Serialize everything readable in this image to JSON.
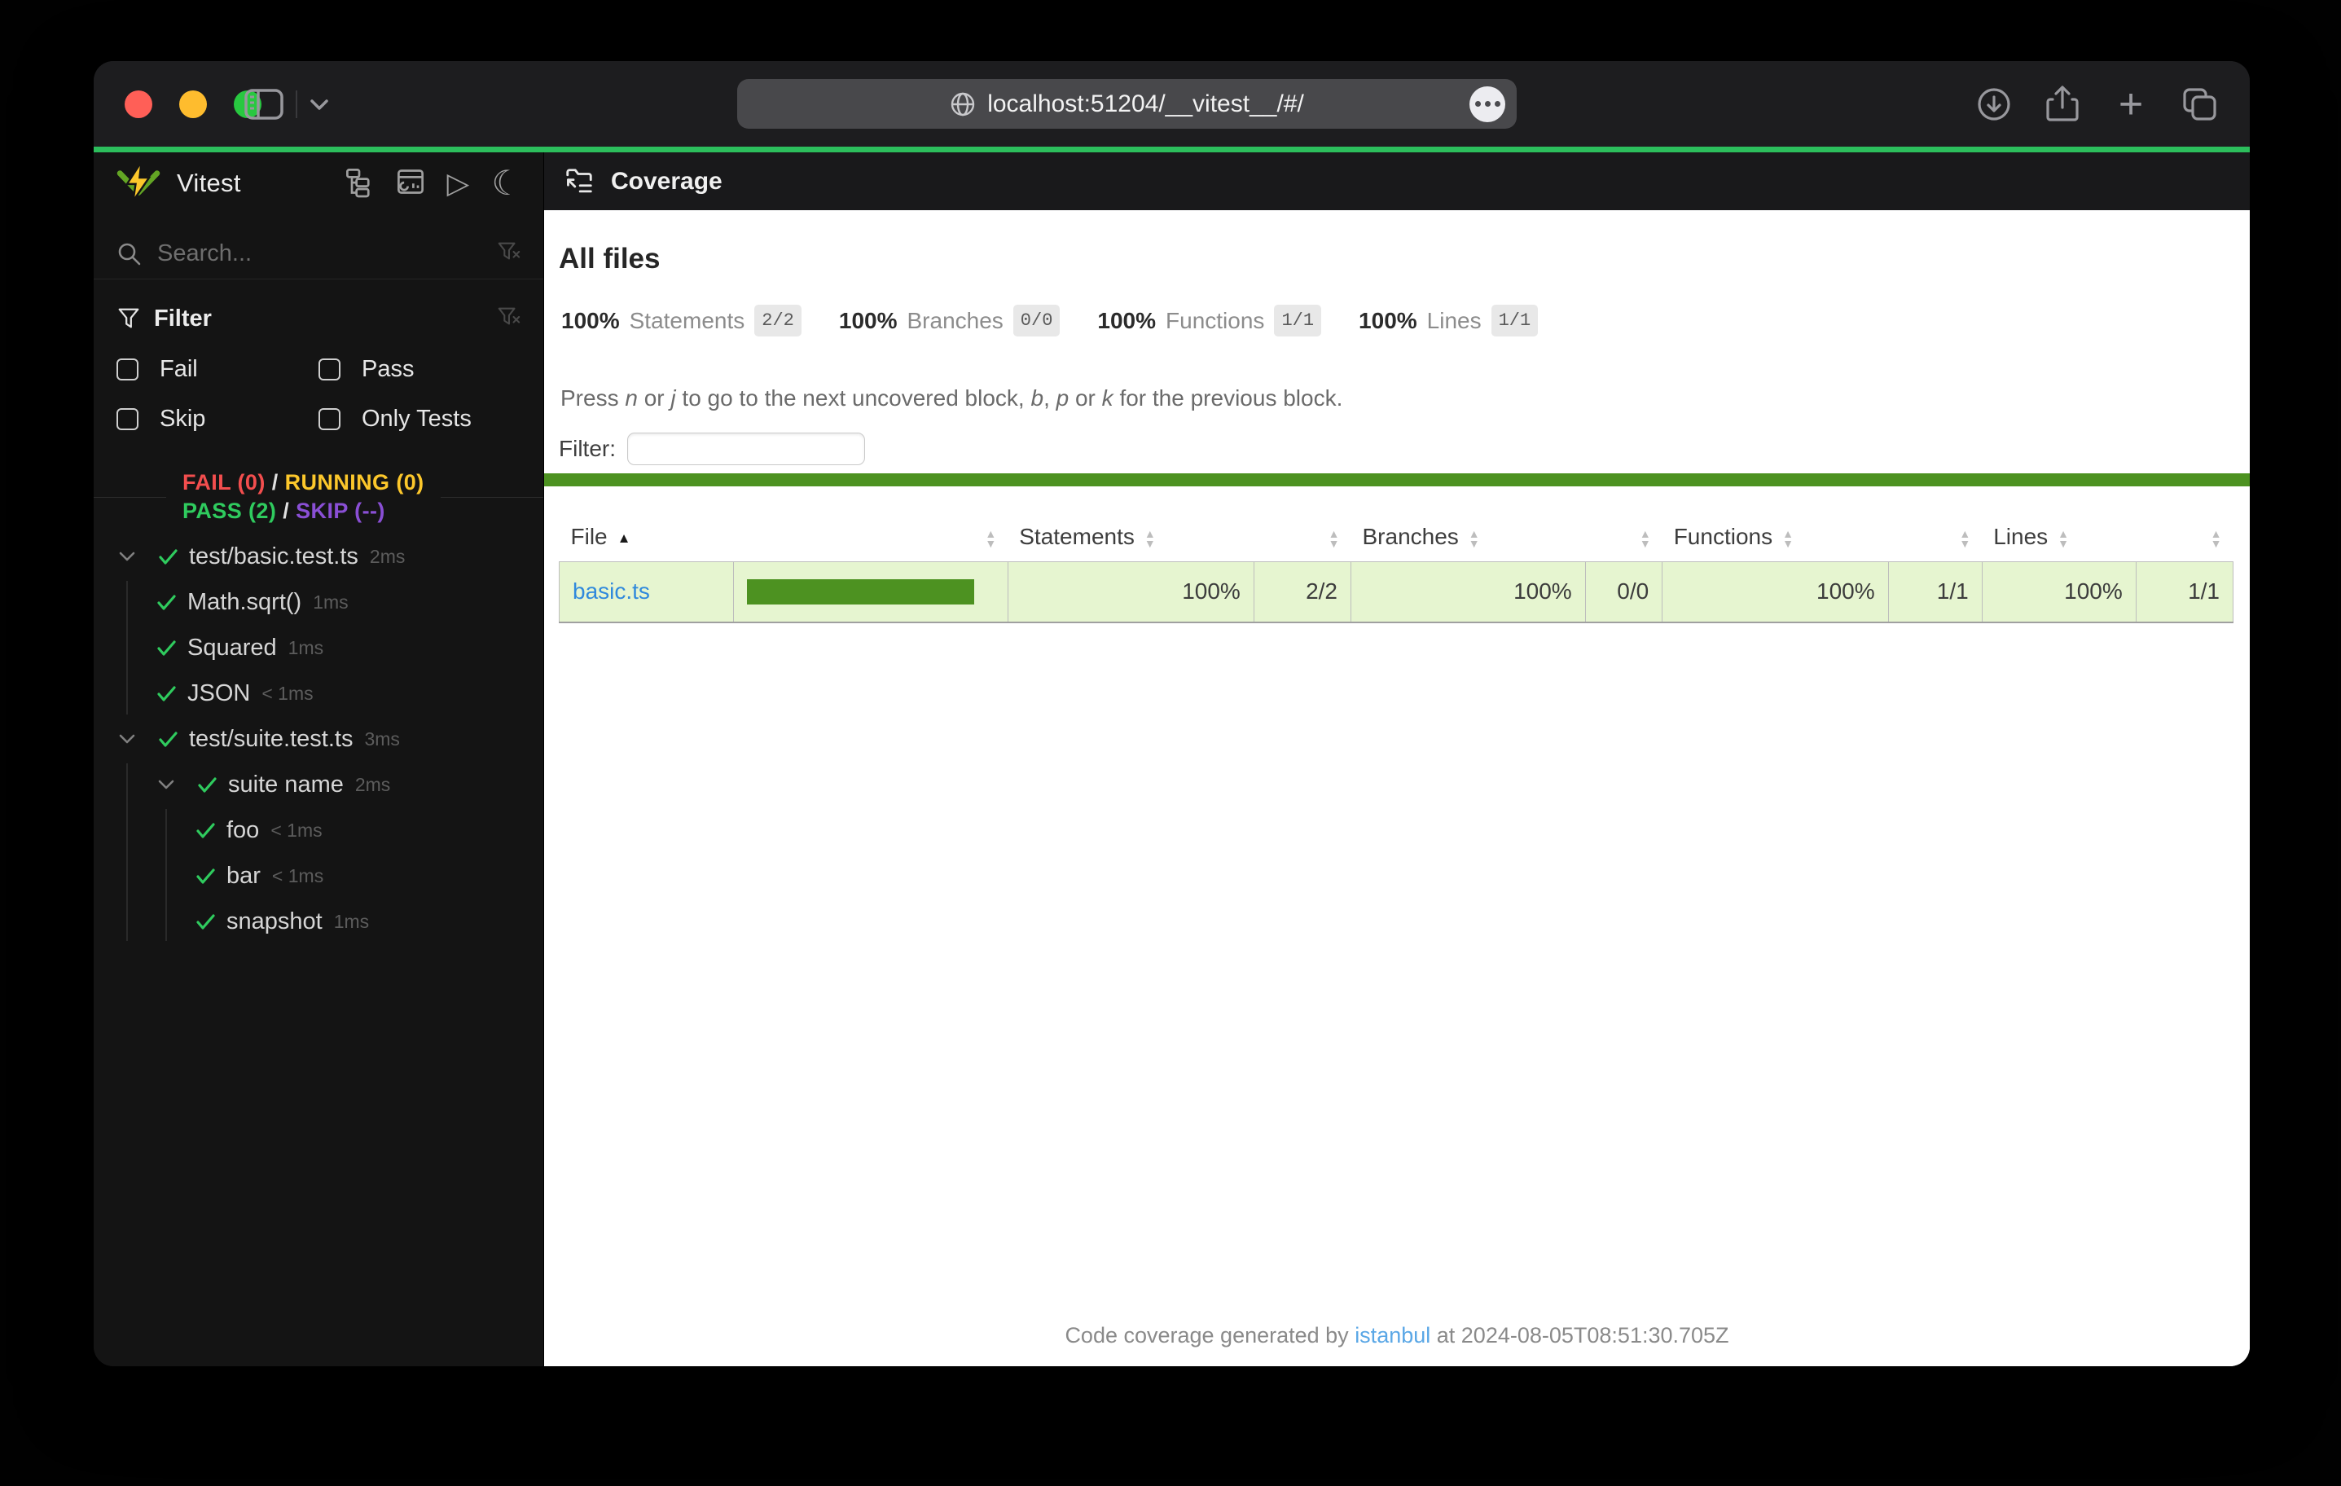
{
  "browser": {
    "url": "localhost:51204/__vitest__/#/"
  },
  "icons": {
    "sort_up": "▲",
    "sort_down": "▼",
    "sort_asc": "▲",
    "play": "▷",
    "moon": "☾",
    "plus": "+"
  },
  "sidebar": {
    "brand": "Vitest",
    "search_placeholder": "Search...",
    "filter_title": "Filter",
    "filter_options": [
      "Fail",
      "Pass",
      "Skip",
      "Only Tests"
    ],
    "status": {
      "fail": "FAIL (0)",
      "sep1": "/",
      "running": "RUNNING (0)",
      "pass": "PASS (2)",
      "sep2": "/",
      "skip": "SKIP (--)"
    },
    "tree": [
      {
        "label": "test/basic.test.ts",
        "duration": "2ms"
      },
      {
        "label": "Math.sqrt()",
        "duration": "1ms"
      },
      {
        "label": "Squared",
        "duration": "1ms"
      },
      {
        "label": "JSON",
        "duration": "< 1ms"
      },
      {
        "label": "test/suite.test.ts",
        "duration": "3ms"
      },
      {
        "label": "suite name",
        "duration": "2ms"
      },
      {
        "label": "foo",
        "duration": "< 1ms"
      },
      {
        "label": "bar",
        "duration": "< 1ms"
      },
      {
        "label": "snapshot",
        "duration": "1ms"
      }
    ]
  },
  "main": {
    "nav_title": "Coverage",
    "heading": "All files",
    "summary": [
      {
        "pct": "100%",
        "label": "Statements",
        "ratio": "2/2"
      },
      {
        "pct": "100%",
        "label": "Branches",
        "ratio": "0/0"
      },
      {
        "pct": "100%",
        "label": "Functions",
        "ratio": "1/1"
      },
      {
        "pct": "100%",
        "label": "Lines",
        "ratio": "1/1"
      }
    ],
    "hint": {
      "p1": "Press ",
      "k1": "n",
      "p2": " or ",
      "k2": "j",
      "p3": " to go to the next uncovered block, ",
      "k3": "b",
      "p4": ", ",
      "k4": "p",
      "p5": " or ",
      "k5": "k",
      "p6": " for the previous block."
    },
    "filter_label": "Filter:",
    "table": {
      "headers": {
        "file": "File",
        "statements": "Statements",
        "branches": "Branches",
        "functions": "Functions",
        "lines": "Lines"
      },
      "row": {
        "file": "basic.ts",
        "statements_pct": "100%",
        "statements_ratio": "2/2",
        "branches_pct": "100%",
        "branches_ratio": "0/0",
        "functions_pct": "100%",
        "functions_ratio": "1/1",
        "lines_pct": "100%",
        "lines_ratio": "1/1"
      }
    },
    "footer": {
      "p1": "Code coverage generated by ",
      "link": "istanbul",
      "p2": " at 2024-08-05T08:51:30.705Z"
    }
  },
  "colors": {
    "traffic_red": "#ff5f57",
    "traffic_yellow": "#febc2e",
    "traffic_green": "#28c840",
    "vitest_progress_green": "#2cbe5c",
    "status_fail": "#f34e4e",
    "status_running": "#fcc72b",
    "status_pass": "#2fcb5e",
    "status_skip": "#8a4fd5",
    "coverage_high_bg": "#e6f5d0",
    "coverage_bar_green": "#4d9221",
    "file_link_blue": "#3089dc",
    "footer_link_blue": "#5aa7e6",
    "vitest_logo_yellow": "#fcc72b",
    "vitest_logo_green": "#63a524"
  }
}
